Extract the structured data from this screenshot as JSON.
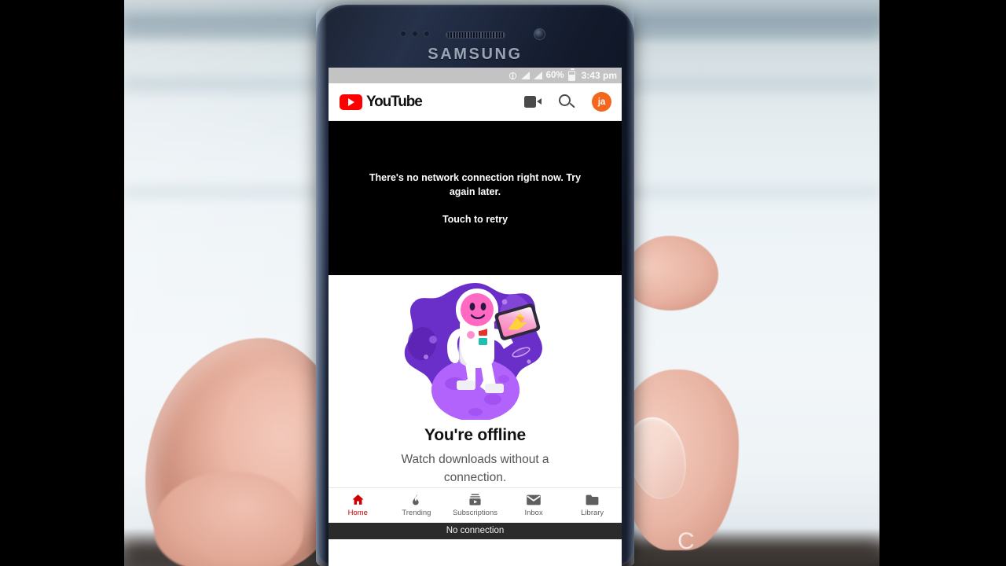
{
  "device": {
    "brand": "SAMSUNG",
    "earpiece_icon": "earpiece-speaker-icon",
    "front_camera_icon": "front-camera-icon",
    "proximity_sensor_icon": "proximity-sensor-icon"
  },
  "status_bar": {
    "sync_icon": "sync-rotate-icon",
    "signal_icon_1": "signal-bars-icon",
    "signal_icon_2": "signal-bars-icon",
    "battery_percent": "60%",
    "battery_icon": "battery-icon",
    "time": "3:43 pm"
  },
  "app_bar": {
    "logo_icon": "youtube-play-logo-icon",
    "wordmark": "YouTube",
    "camera_icon": "video-camera-icon",
    "search_icon": "search-icon",
    "avatar_initials": "ja"
  },
  "video_panel": {
    "error_message": "There's no network connection right now. Try again later.",
    "retry_label": "Touch to retry"
  },
  "offline": {
    "illustration_icon": "astronaut-on-moon-illustration",
    "title": "You're offline",
    "subtitle": "Watch downloads without a connection."
  },
  "bottom_nav": {
    "items": [
      {
        "label": "Home",
        "icon": "home-icon",
        "active": true
      },
      {
        "label": "Trending",
        "icon": "flame-icon",
        "active": false
      },
      {
        "label": "Subscriptions",
        "icon": "subscriptions-icon",
        "active": false
      },
      {
        "label": "Inbox",
        "icon": "envelope-icon",
        "active": false
      },
      {
        "label": "Library",
        "icon": "folder-icon",
        "active": false
      }
    ]
  },
  "snackbar": {
    "message": "No connection"
  },
  "watermark": {
    "glyph": "C"
  },
  "colors": {
    "youtube_red": "#ff0000",
    "active_nav_red": "#cc0000",
    "avatar_orange": "#f4661c",
    "status_bar_gray": "#c3c3c3",
    "snackbar_dark": "#2b2b2b",
    "illustration_purple": "#6b2fc9",
    "illustration_light_purple": "#a855f7"
  }
}
